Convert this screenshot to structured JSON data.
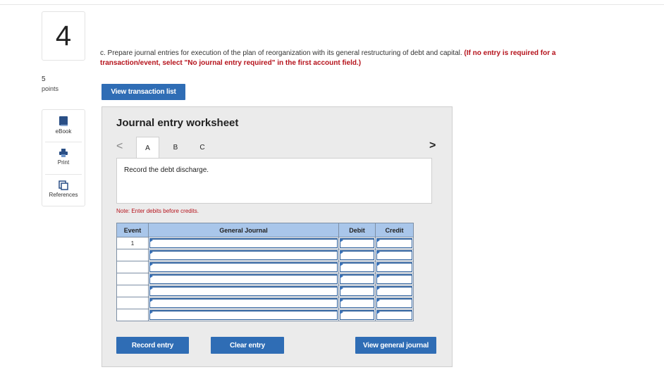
{
  "question": {
    "number": "4",
    "points_value": "5",
    "points_label": "points",
    "prompt": "c. Prepare journal entries for execution of the plan of reorganization with its general restructuring of debt and capital.",
    "instruction": "(If no entry is required for a transaction/event, select \"No journal entry required\" in the first account field.)"
  },
  "sidebar": {
    "items": [
      {
        "label": "eBook",
        "icon": "book-icon"
      },
      {
        "label": "Print",
        "icon": "printer-icon"
      },
      {
        "label": "References",
        "icon": "references-icon"
      }
    ]
  },
  "buttons": {
    "view_transaction_list": "View transaction list",
    "record_entry": "Record entry",
    "clear_entry": "Clear entry",
    "view_general_journal": "View general journal"
  },
  "worksheet": {
    "title": "Journal entry worksheet",
    "tabs": [
      "A",
      "B",
      "C"
    ],
    "active_tab": "A",
    "nav_prev": "<",
    "nav_next": ">",
    "description": "Record the debt discharge.",
    "note": "Note: Enter debits before credits."
  },
  "journal_table": {
    "headers": [
      "Event",
      "General Journal",
      "Debit",
      "Credit"
    ],
    "rows": [
      {
        "event": "1"
      },
      {
        "event": ""
      },
      {
        "event": ""
      },
      {
        "event": ""
      },
      {
        "event": ""
      },
      {
        "event": ""
      },
      {
        "event": ""
      }
    ]
  },
  "colors": {
    "accent_button": "#2f6db5",
    "header_fill": "#a9c6ea",
    "warning_text": "#b5121b"
  }
}
